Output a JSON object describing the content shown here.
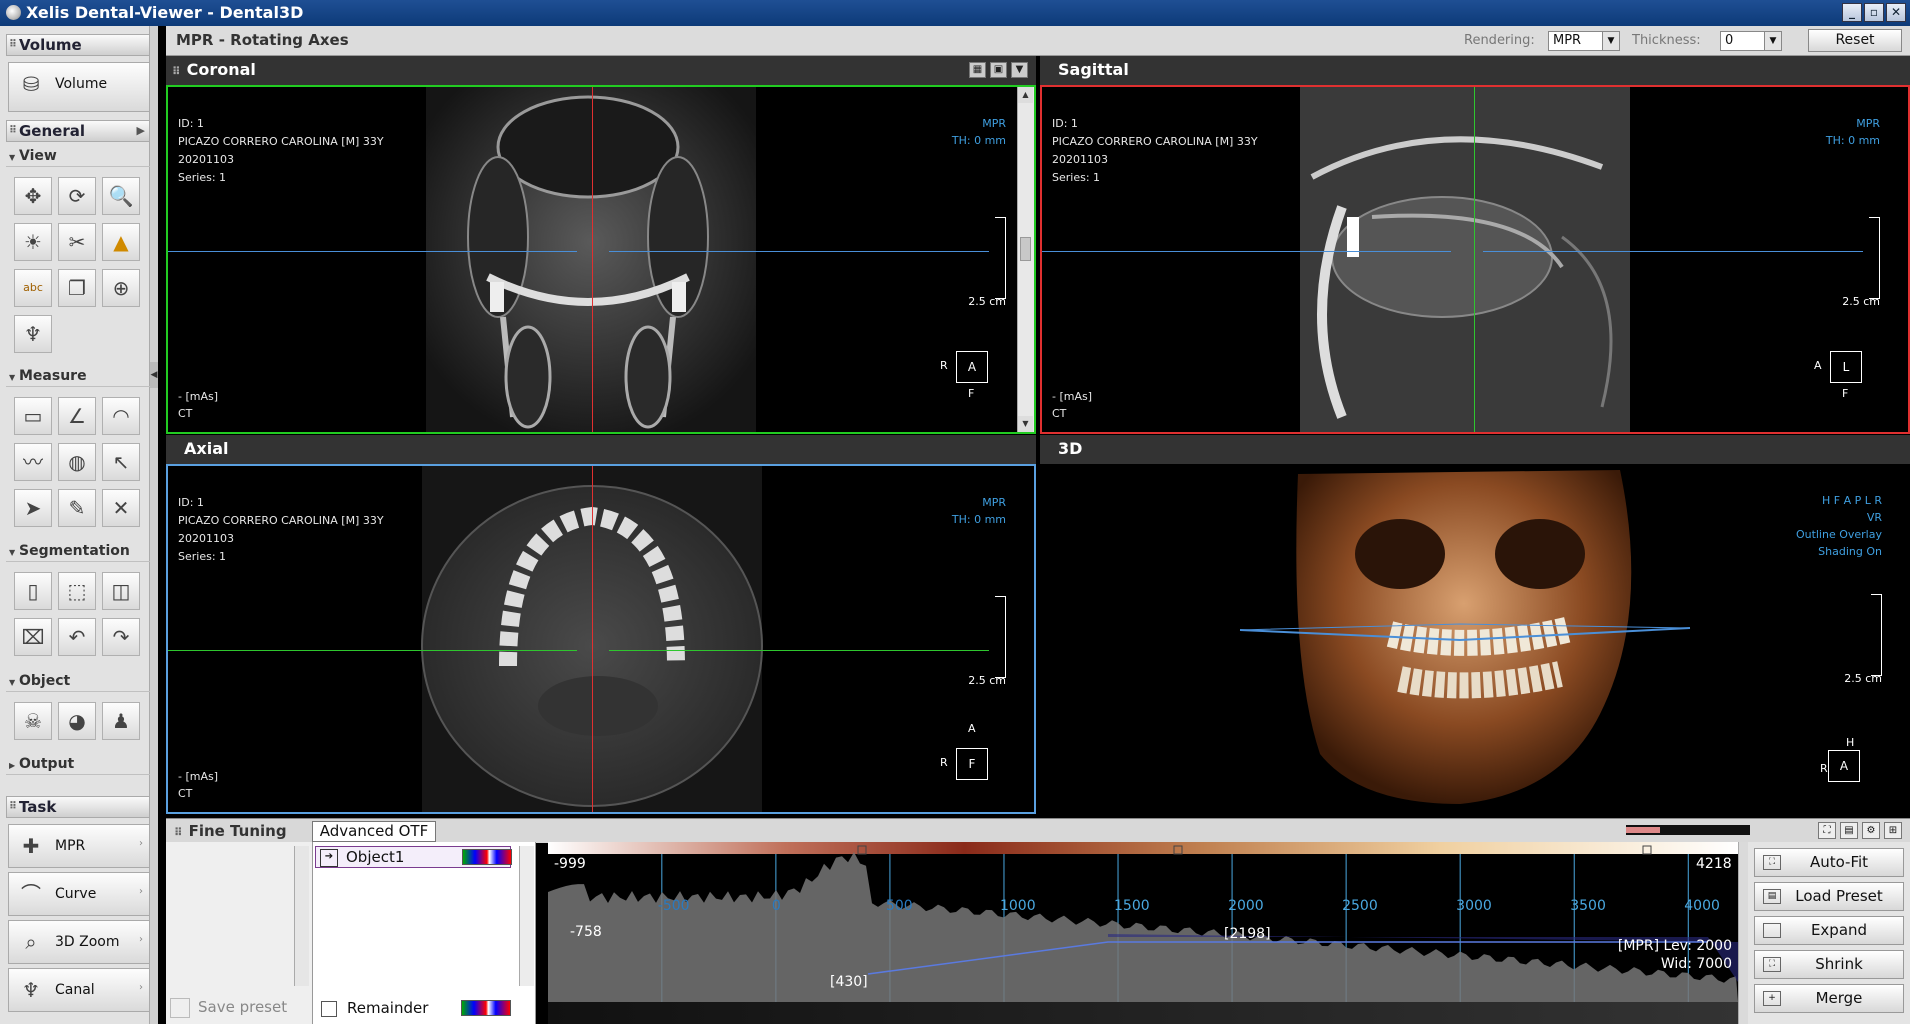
{
  "window": {
    "title": "Xelis Dental-Viewer - Dental3D",
    "buttons": [
      "_",
      "▫",
      "✕"
    ]
  },
  "sidebar": {
    "volume": {
      "section": "Volume",
      "button": "Volume"
    },
    "general": {
      "section": "General"
    },
    "view": {
      "label": "View",
      "tools": [
        "pan-icon",
        "rotate-icon",
        "zoom-icon",
        "brightness-icon",
        "flip-icon",
        "warning-triangle-icon",
        "text-annotation-icon",
        "copy-icon",
        "crosshair-icon",
        "tooth-icon"
      ]
    },
    "measure": {
      "label": "Measure",
      "tools": [
        "ruler-icon",
        "angle-icon",
        "protractor-icon",
        "profile-icon",
        "globe-icon",
        "pointer-icon",
        "arrow-icon",
        "eraser-icon",
        "delete-icon"
      ]
    },
    "segmentation": {
      "label": "Segmentation",
      "tools": [
        "brush-icon",
        "fill-icon",
        "layers-icon",
        "cut-icon",
        "undo-icon",
        "redo-icon"
      ]
    },
    "object": {
      "label": "Object",
      "tools": [
        "skull-icon",
        "head-icon",
        "bust-icon"
      ]
    },
    "output": {
      "label": "Output"
    },
    "task": {
      "section": "Task",
      "items": [
        "MPR",
        "Curve",
        "3D Zoom",
        "Canal"
      ]
    }
  },
  "mpr": {
    "title": "MPR - Rotating Axes",
    "rendering_label": "Rendering:",
    "rendering_value": "MPR",
    "thickness_label": "Thickness:",
    "thickness_value": "0",
    "reset": "Reset"
  },
  "patient": {
    "id": "ID: 1",
    "name": "PICAZO CORRERO CAROLINA [M] 33Y",
    "date": "20201103",
    "series": "Series: 1",
    "mas": "- [mAs]",
    "modality": "CT"
  },
  "views": {
    "coronal": {
      "title": "Coronal",
      "mode": "MPR",
      "th": "TH: 0 mm",
      "scale": "2.5 cm",
      "orient": "A",
      "left": "R",
      "bottom": "F"
    },
    "sagittal": {
      "title": "Sagittal",
      "mode": "MPR",
      "th": "TH: 0 mm",
      "scale": "2.5 cm",
      "orient": "L",
      "left": "A",
      "bottom": "F"
    },
    "axial": {
      "title": "Axial",
      "mode": "MPR",
      "th": "TH: 0 mm",
      "scale": "2.5 cm",
      "orient": "F",
      "left": "R",
      "top": "A"
    },
    "three_d": {
      "title": "3D",
      "dirs": "H F A P L R",
      "vr": "VR",
      "overlay": "Outline Overlay",
      "shading": "Shading On",
      "scale": "2.5 cm",
      "cube_top": "H",
      "cube_face": "A",
      "cube_left": "R"
    }
  },
  "fine_tuning": {
    "title": "Fine Tuning",
    "tab": "Advanced OTF",
    "save_preset": "Save preset",
    "object": "Object1",
    "remainder": "Remainder",
    "hist": {
      "min": "-999",
      "max": "4218",
      "low": "-758",
      "ticks": [
        "-500",
        "0",
        "500",
        "1000",
        "1500",
        "2000",
        "2500",
        "3000",
        "3500",
        "4000"
      ],
      "point1": "[430]",
      "point2": "[2198]",
      "lev": "[MPR] Lev: 2000",
      "wid": "Wid: 7000"
    },
    "buttons": [
      "Auto-Fit",
      "Load Preset",
      "Expand",
      "Shrink",
      "Merge"
    ]
  },
  "colors": {
    "accent_coronal": "#22cc22",
    "accent_sagittal": "#e03030",
    "accent_axial": "#5aa0e0"
  }
}
